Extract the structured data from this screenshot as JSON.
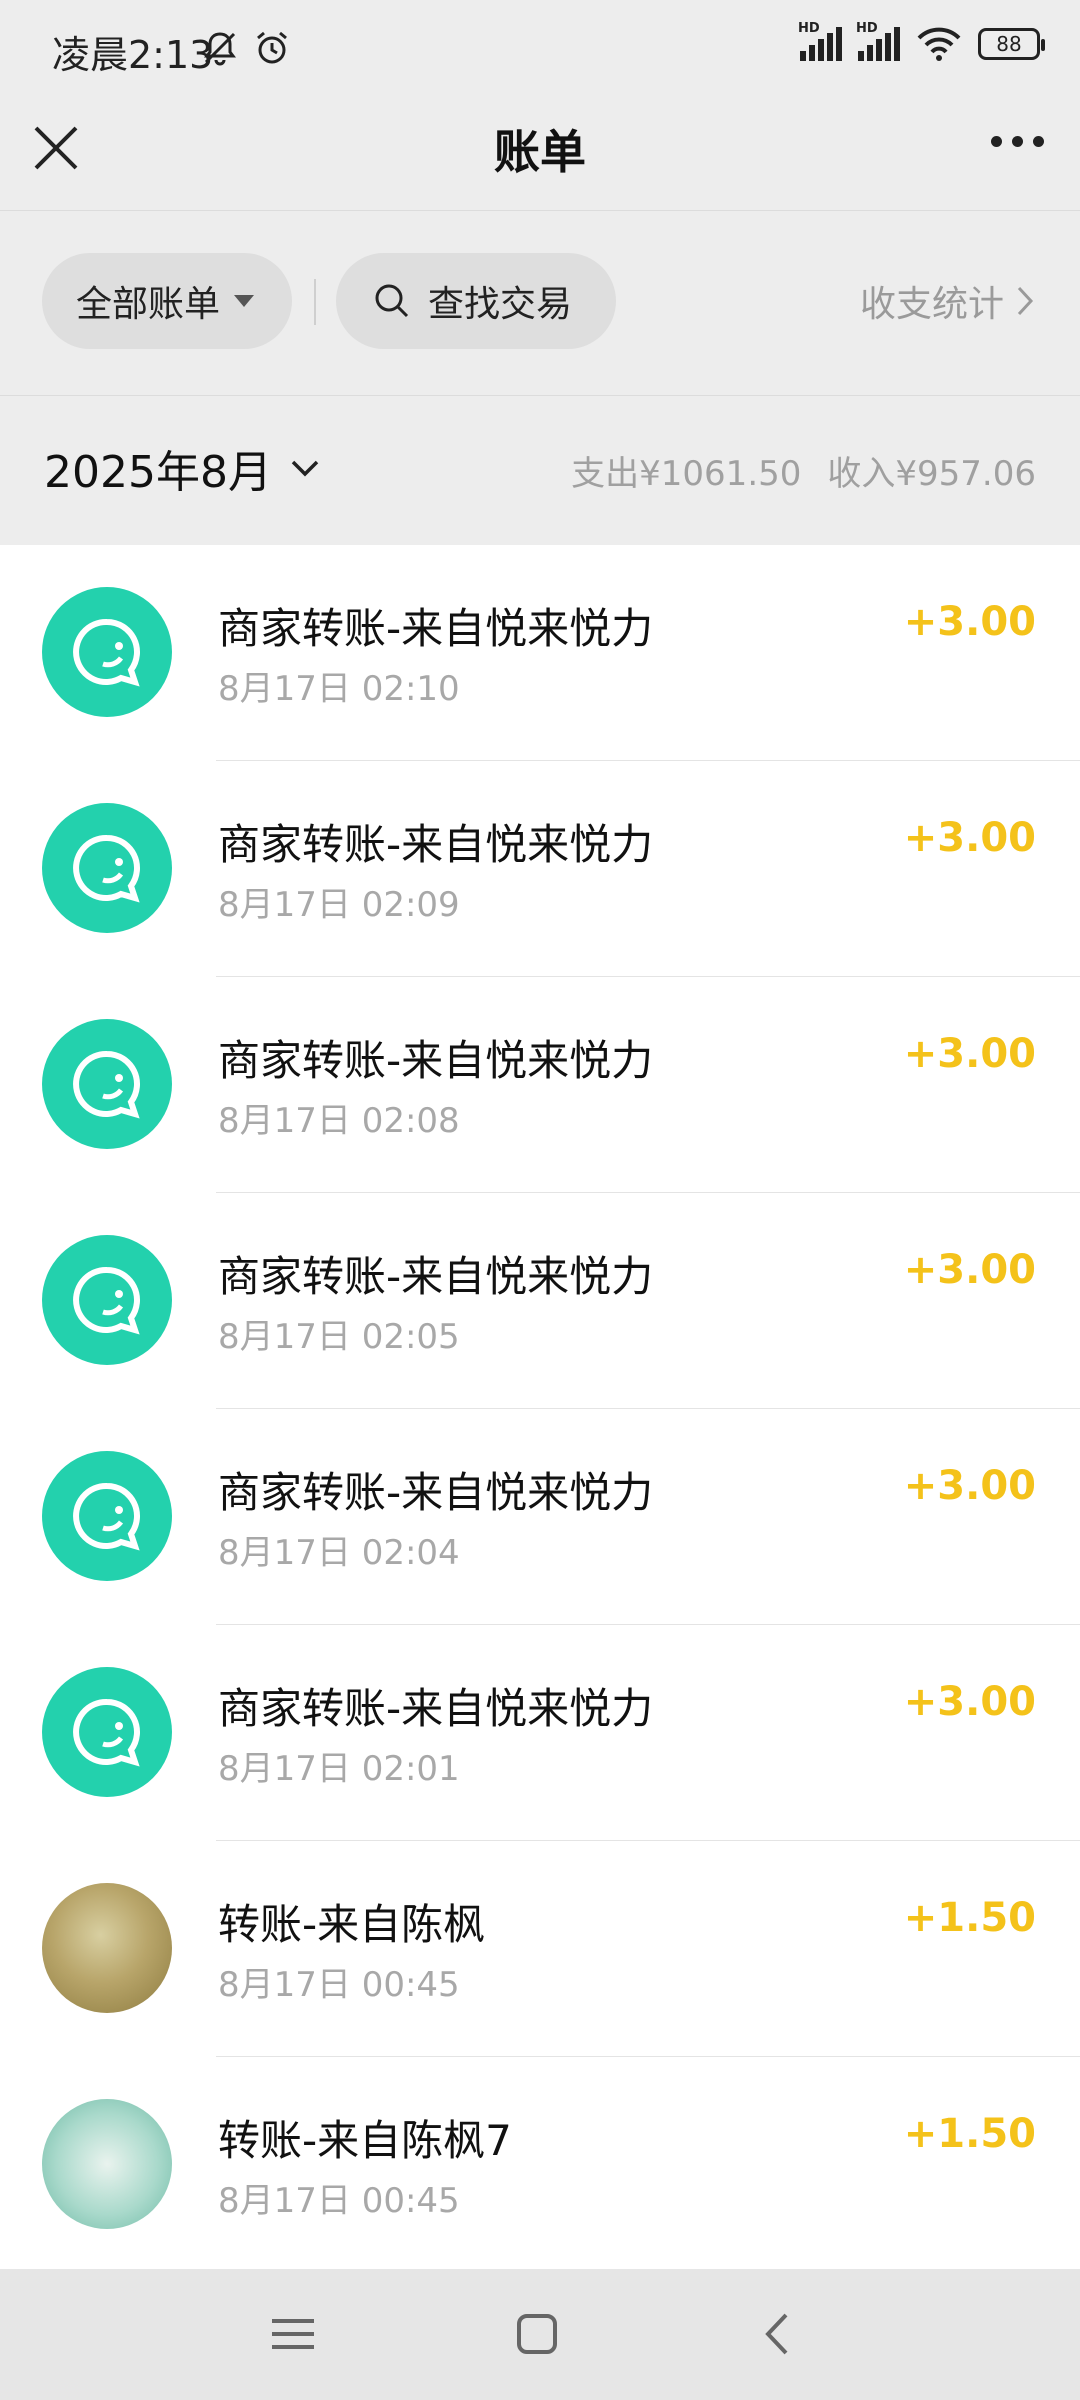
{
  "status_bar": {
    "time": "凌晨2:13",
    "hd1": "HD",
    "hd2": "HD",
    "battery": "88"
  },
  "header": {
    "title": "账单"
  },
  "filters": {
    "all_bills": "全部账单",
    "search": "查找交易",
    "stats": "收支统计"
  },
  "month": {
    "label": "2025年8月",
    "expense": "支出¥1061.50",
    "income": "收入¥957.06"
  },
  "transactions": [
    {
      "name": "商家转账-来自悦来悦力",
      "time": "8月17日 02:10",
      "amount": "+3.00",
      "avatar": "merchant-transfer-icon"
    },
    {
      "name": "商家转账-来自悦来悦力",
      "time": "8月17日 02:09",
      "amount": "+3.00",
      "avatar": "merchant-transfer-icon"
    },
    {
      "name": "商家转账-来自悦来悦力",
      "time": "8月17日 02:08",
      "amount": "+3.00",
      "avatar": "merchant-transfer-icon"
    },
    {
      "name": "商家转账-来自悦来悦力",
      "time": "8月17日 02:05",
      "amount": "+3.00",
      "avatar": "merchant-transfer-icon"
    },
    {
      "name": "商家转账-来自悦来悦力",
      "time": "8月17日 02:04",
      "amount": "+3.00",
      "avatar": "merchant-transfer-icon"
    },
    {
      "name": "商家转账-来自悦来悦力",
      "time": "8月17日 02:01",
      "amount": "+3.00",
      "avatar": "merchant-transfer-icon"
    },
    {
      "name": "转账-来自陈枫",
      "time": "8月17日 00:45",
      "amount": "+1.50",
      "avatar": "user-photo"
    },
    {
      "name": "转账-来自陈枫7",
      "time": "8月17日 00:45",
      "amount": "+1.50",
      "avatar": "user-photo"
    }
  ],
  "colors": {
    "accent_teal": "#23d1ad",
    "income_amount": "#f4c21a",
    "background": "#ededed"
  }
}
